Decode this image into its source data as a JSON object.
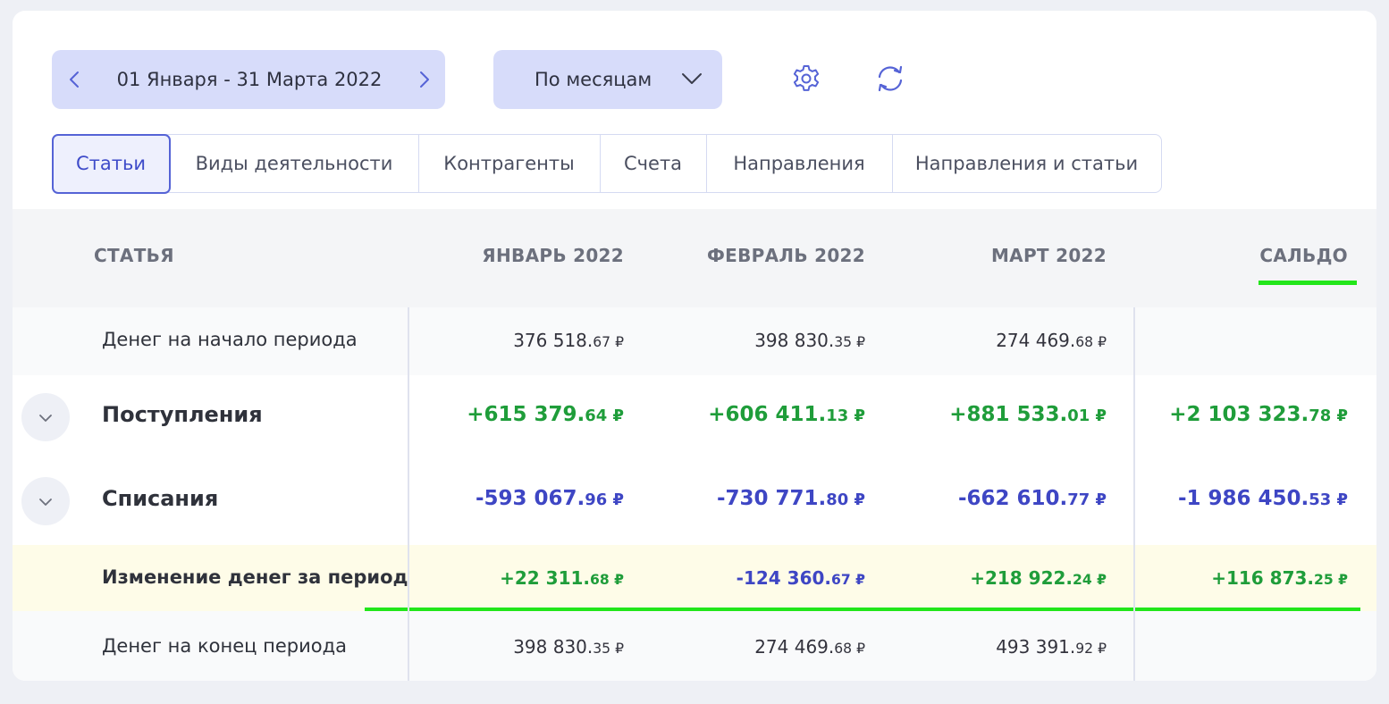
{
  "toolbar": {
    "period_label": "01 Января - 31 Марта 2022",
    "group_label": "По месяцам"
  },
  "tabs": [
    {
      "label": "Статьи",
      "active": true
    },
    {
      "label": "Виды деятельности",
      "active": false
    },
    {
      "label": "Контрагенты",
      "active": false
    },
    {
      "label": "Счета",
      "active": false
    },
    {
      "label": "Направления",
      "active": false
    },
    {
      "label": "Направления и статьи",
      "active": false
    }
  ],
  "table": {
    "headers": [
      "СТАТЬЯ",
      "ЯНВАРЬ 2022",
      "ФЕВРАЛЬ 2022",
      "МАРТ 2022",
      "САЛЬДО"
    ],
    "rows": [
      {
        "name": "Денег на начало периода",
        "cells": [
          {
            "main": "376 518.",
            "cents": "67 ₽"
          },
          {
            "main": "398 830.",
            "cents": "35 ₽"
          },
          {
            "main": "274 469.",
            "cents": "68 ₽"
          },
          {
            "main": "",
            "cents": ""
          }
        ]
      },
      {
        "name": "Поступления",
        "cells": [
          {
            "main": "+615 379.",
            "cents": "64 ₽"
          },
          {
            "main": "+606 411.",
            "cents": "13 ₽"
          },
          {
            "main": "+881 533.",
            "cents": "01 ₽"
          },
          {
            "main": "+2 103 323.",
            "cents": "78 ₽"
          }
        ]
      },
      {
        "name": "Списания",
        "cells": [
          {
            "main": "-593 067.",
            "cents": "96 ₽"
          },
          {
            "main": "-730 771.",
            "cents": "80 ₽"
          },
          {
            "main": "-662 610.",
            "cents": "77 ₽"
          },
          {
            "main": "-1 986 450.",
            "cents": "53 ₽"
          }
        ]
      },
      {
        "name": "Изменение денег за период",
        "cells": [
          {
            "main": "+22 311.",
            "cents": "68 ₽"
          },
          {
            "main": "-124 360.",
            "cents": "67 ₽"
          },
          {
            "main": "+218 922.",
            "cents": "24 ₽"
          },
          {
            "main": "+116 873.",
            "cents": "25 ₽"
          }
        ]
      },
      {
        "name": "Денег на конец периода",
        "cells": [
          {
            "main": "398 830.",
            "cents": "35 ₽"
          },
          {
            "main": "274 469.",
            "cents": "68 ₽"
          },
          {
            "main": "493 391.",
            "cents": "92 ₽"
          },
          {
            "main": "",
            "cents": ""
          }
        ]
      }
    ]
  },
  "colors": {
    "positive": "#1f9d3a",
    "negative": "#3e46c4",
    "accent": "#5563d6",
    "highlight_marker": "#22e61a",
    "change_row_bg": "#fefce8"
  },
  "icons": [
    "chevron-left-icon",
    "chevron-right-icon",
    "chevron-down-icon",
    "gear-icon",
    "refresh-icon"
  ]
}
